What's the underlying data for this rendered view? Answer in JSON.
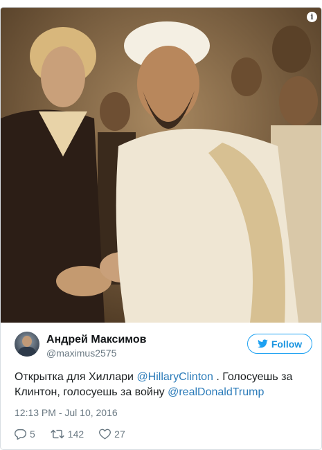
{
  "media": {
    "info_icon": "info-icon",
    "description_colors": {
      "sepia_bg": "#7a5f3e"
    }
  },
  "author": {
    "name": "Андрей Максимов",
    "handle": "@maximus2575",
    "avatar_icon": "user-avatar"
  },
  "follow": {
    "label": "Follow",
    "icon": "twitter-bird-icon",
    "color": "#1da1f2"
  },
  "tweet": {
    "text_part1": "Открытка для Хиллари ",
    "mention1": "@HillaryClinton",
    "text_part2": " . Голосуешь за Клинтон, голосуешь за войну ",
    "mention2": "@realDonaldTrump",
    "link_color": "#2b7bb9"
  },
  "timestamp": "12:13 PM - Jul 10, 2016",
  "actions": {
    "replies": "5",
    "retweets": "142",
    "likes": "27",
    "reply_icon": "reply-icon",
    "retweet_icon": "retweet-icon",
    "like_icon": "heart-icon"
  }
}
